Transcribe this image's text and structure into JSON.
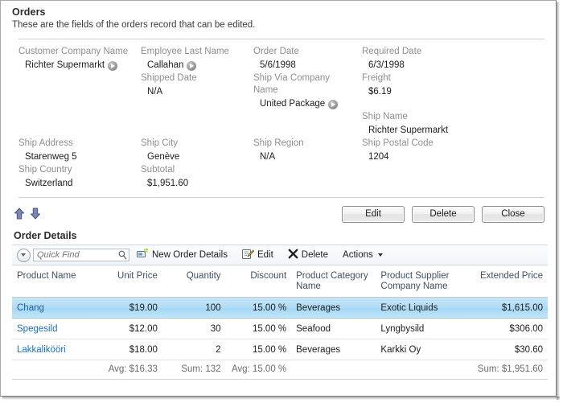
{
  "window": {
    "title": "Orders",
    "subtitle": "These are the fields of the orders record that can be edited."
  },
  "form": {
    "rows": [
      [
        {
          "label": "Customer Company Name",
          "value": "Richter Supermarkt",
          "lookup": true
        },
        {
          "label": "Employee Last Name",
          "value": "Callahan",
          "lookup": true
        },
        {
          "label": "Order Date",
          "value": "5/6/1998",
          "lookup": false
        },
        {
          "label": "Required Date",
          "value": "6/3/1998",
          "lookup": false
        }
      ],
      [
        {
          "label": "",
          "value": "",
          "lookup": false
        },
        {
          "label": "Shipped Date",
          "value": "N/A",
          "lookup": false
        },
        {
          "label": "Ship Via Company Name",
          "value": "United Package",
          "lookup": true
        },
        {
          "label": "Freight",
          "value": "$6.19",
          "lookup": false
        }
      ],
      [
        {
          "label": "",
          "value": "",
          "lookup": false
        },
        {
          "label": "",
          "value": "",
          "lookup": false
        },
        {
          "label": "",
          "value": "",
          "lookup": false
        },
        {
          "label": "Ship Name",
          "value": "Richter Supermarkt",
          "lookup": false
        }
      ],
      [
        {
          "label": "Ship Address",
          "value": "Starenweg 5",
          "lookup": false
        },
        {
          "label": "Ship City",
          "value": "Genève",
          "lookup": false
        },
        {
          "label": "Ship Region",
          "value": "N/A",
          "lookup": false
        },
        {
          "label": "Ship Postal Code",
          "value": "1204",
          "lookup": false
        }
      ],
      [
        {
          "label": "Ship Country",
          "value": "Switzerland",
          "lookup": false
        },
        {
          "label": "Subtotal",
          "value": "$1,951.60",
          "lookup": false
        },
        {
          "label": "",
          "value": "",
          "lookup": false
        },
        {
          "label": "",
          "value": "",
          "lookup": false
        }
      ]
    ]
  },
  "action_bar": {
    "nav": [
      {
        "icon": "arrow-up-icon",
        "name": "previous-record-arrow"
      },
      {
        "icon": "arrow-down-icon",
        "name": "next-record-arrow"
      }
    ],
    "buttons": [
      {
        "label": "Edit",
        "name": "edit-button"
      },
      {
        "label": "Delete",
        "name": "delete-button"
      },
      {
        "label": "Close",
        "name": "close-button"
      }
    ]
  },
  "details": {
    "section_title": "Order Details",
    "toolbar": {
      "quick_find_placeholder": "Quick Find",
      "quick_find_value": "",
      "items": [
        {
          "label": "New Order Details",
          "icon": "new-record-icon",
          "name": "new-order-details-button"
        },
        {
          "label": "Edit",
          "icon": "edit-pencil-icon",
          "name": "grid-edit-button"
        },
        {
          "label": "Delete",
          "icon": "delete-x-icon",
          "name": "grid-delete-button"
        },
        {
          "label": "Actions",
          "icon": "chevron-down-icon",
          "name": "actions-menu-button"
        }
      ]
    },
    "columns": [
      {
        "label": "Product Name",
        "align": "left",
        "width": "16%"
      },
      {
        "label": "Unit Price",
        "align": "right",
        "width": "12%"
      },
      {
        "label": "Quantity",
        "align": "right",
        "width": "11.5%"
      },
      {
        "label": "Discount",
        "align": "right",
        "width": "12%"
      },
      {
        "label": "Product Category Name",
        "align": "left",
        "width": "16%"
      },
      {
        "label": "Product Supplier Company Name",
        "align": "left",
        "width": "18%"
      },
      {
        "label": "Extended Price",
        "align": "right",
        "width": "14.5%"
      }
    ],
    "rows": [
      {
        "selected": true,
        "product_name": "Chang",
        "unit_price": "$19.00",
        "quantity": "100",
        "discount": "15.00 %",
        "category": "Beverages",
        "supplier": "Exotic Liquids",
        "extended_price": "$1,615.00"
      },
      {
        "selected": false,
        "product_name": "Spegesild",
        "unit_price": "$12.00",
        "quantity": "30",
        "discount": "15.00 %",
        "category": "Seafood",
        "supplier": "Lyngbysild",
        "extended_price": "$306.00"
      },
      {
        "selected": false,
        "product_name": "Lakkalikööri",
        "unit_price": "$18.00",
        "quantity": "2",
        "discount": "15.00 %",
        "category": "Beverages",
        "supplier": "Karkki Oy",
        "extended_price": "$30.60"
      }
    ],
    "summary": {
      "product_name": "",
      "unit_price": "Avg: $16.33",
      "quantity": "Sum: 132",
      "discount": "Avg: 15.00 %",
      "category": "",
      "supplier": "",
      "extended_price": "Sum: $1,951.60"
    }
  },
  "colors": {
    "accent_link": "#1f6fb5",
    "selected_row": "#aedcf6",
    "label_gray": "#8e8e8e",
    "header_text": "#3f5063"
  }
}
